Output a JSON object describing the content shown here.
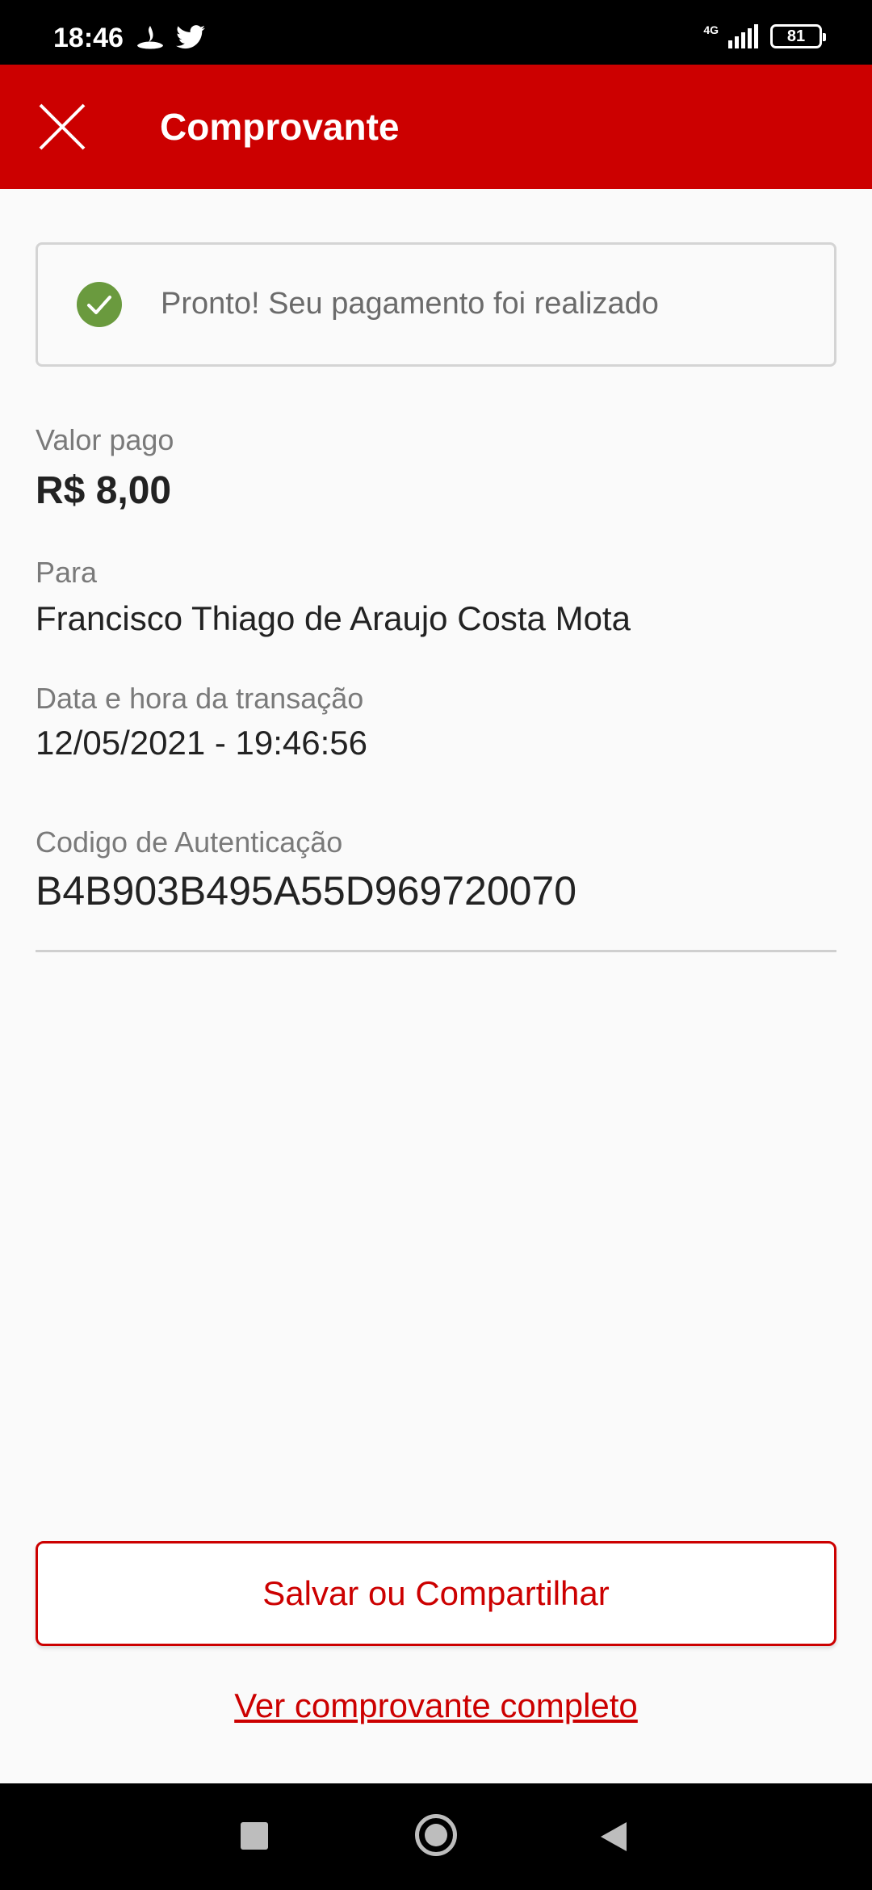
{
  "status_bar": {
    "time": "18:46",
    "network": "4G",
    "battery": "81",
    "app_icons": [
      "santander-icon",
      "twitter-icon"
    ]
  },
  "app_bar": {
    "title": "Comprovante",
    "background": "#cc0000"
  },
  "success_banner": {
    "message": "Pronto! Seu pagamento foi realizado",
    "icon": "check-circle-icon",
    "icon_color": "#6a9a3e"
  },
  "receipt": {
    "amount_label": "Valor pago",
    "amount": "R$ 8,00",
    "recipient_label": "Para",
    "recipient": "Francisco Thiago de Araujo Costa Mota",
    "datetime_label": "Data e hora da transação",
    "datetime": "12/05/2021 - 19:46:56",
    "auth_label": "Codigo de Autenticação",
    "auth_code": "B4B903B495A55D969720070"
  },
  "actions": {
    "save_share": "Salvar ou Compartilhar",
    "view_full": "Ver comprovante completo"
  },
  "nav_bar": {
    "buttons": [
      "recent-apps-icon",
      "home-icon",
      "back-icon"
    ]
  }
}
